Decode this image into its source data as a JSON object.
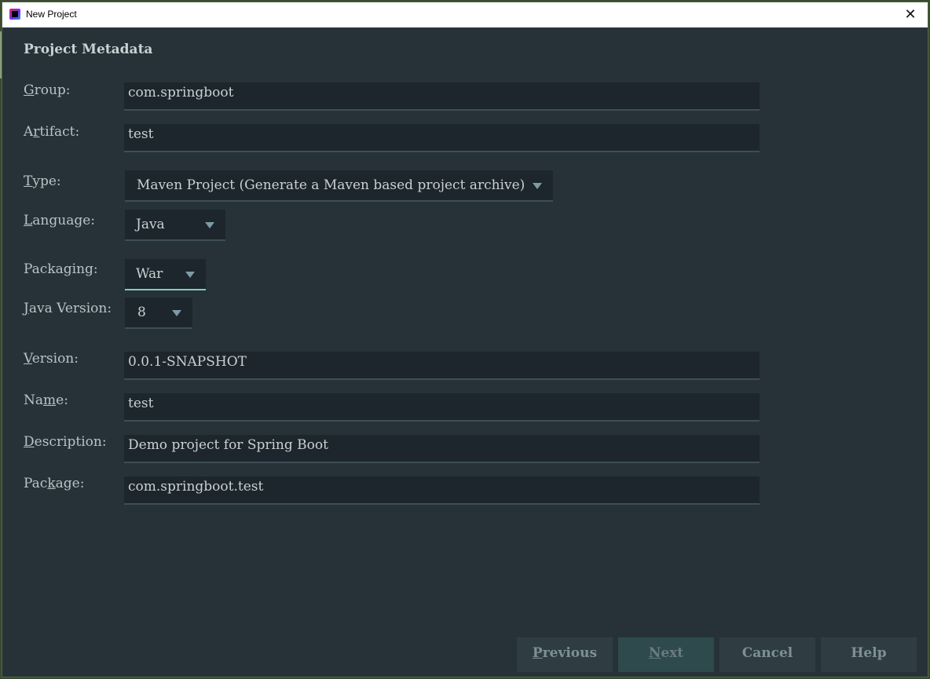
{
  "window": {
    "title": "New Project"
  },
  "section_title": "Project Metadata",
  "fields": {
    "group": {
      "label_pre": "",
      "label_mn": "G",
      "label_post": "roup:",
      "value": "com.springboot"
    },
    "artifact": {
      "label_pre": "A",
      "label_mn": "r",
      "label_post": "tifact:",
      "value": "test"
    },
    "type": {
      "label_pre": "",
      "label_mn": "T",
      "label_post": "ype:",
      "value": "Maven Project (Generate a Maven based project archive)"
    },
    "language": {
      "label_pre": "",
      "label_mn": "L",
      "label_post": "anguage:",
      "value": "Java"
    },
    "packaging": {
      "label": "Packaging:",
      "value": "War"
    },
    "java_version": {
      "label_pre": "",
      "label_mn": "J",
      "label_post": "ava Version:",
      "value": "8"
    },
    "version": {
      "label_pre": "",
      "label_mn": "V",
      "label_post": "ersion:",
      "value": "0.0.1-SNAPSHOT"
    },
    "name": {
      "label_pre": "Na",
      "label_mn": "m",
      "label_post": "e:",
      "value": "test"
    },
    "description": {
      "label_pre": "",
      "label_mn": "D",
      "label_post": "escription:",
      "value": "Demo project for Spring Boot"
    },
    "package": {
      "label_pre": "Pac",
      "label_mn": "k",
      "label_post": "age:",
      "value": "com.springboot.test"
    }
  },
  "buttons": {
    "previous": {
      "mn": "P",
      "rest": "revious"
    },
    "next": {
      "mn": "N",
      "rest": "ext"
    },
    "cancel": "Cancel",
    "help": "Help"
  },
  "icons": {
    "app": "intellij-idea-icon",
    "close": "close-icon",
    "dropdown": "chevron-down-icon"
  },
  "colors": {
    "background": "#263238",
    "field": "#1d262c",
    "accent": "#80cbc4"
  }
}
